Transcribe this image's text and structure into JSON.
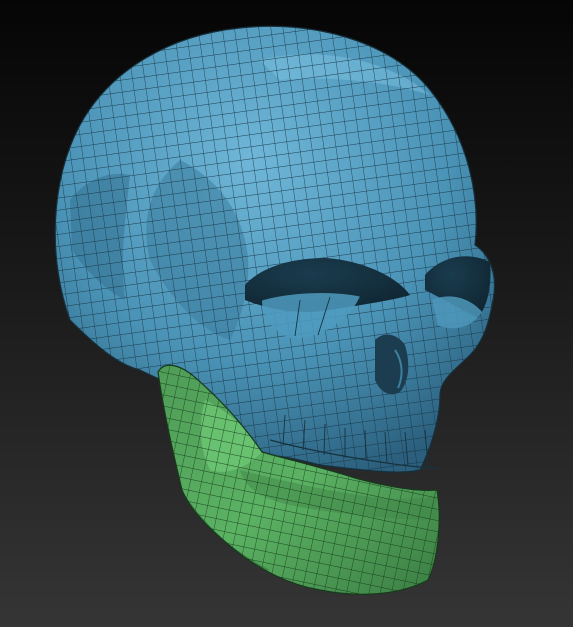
{
  "viewport": {
    "background_top": "#050505",
    "background_bottom": "#353535"
  },
  "model": {
    "subject": "skull",
    "display": "quad-wireframe-shaded",
    "polygroups": [
      {
        "id": "cranium",
        "color": "#4a93b6",
        "color_light": "#6cb4d6",
        "color_dark": "#2d6483",
        "wire": "#17323f"
      },
      {
        "id": "jaw",
        "color": "#4c9e55",
        "color_light": "#6dc774",
        "color_dark": "#2f6b37",
        "wire": "#173a1c"
      }
    ]
  }
}
